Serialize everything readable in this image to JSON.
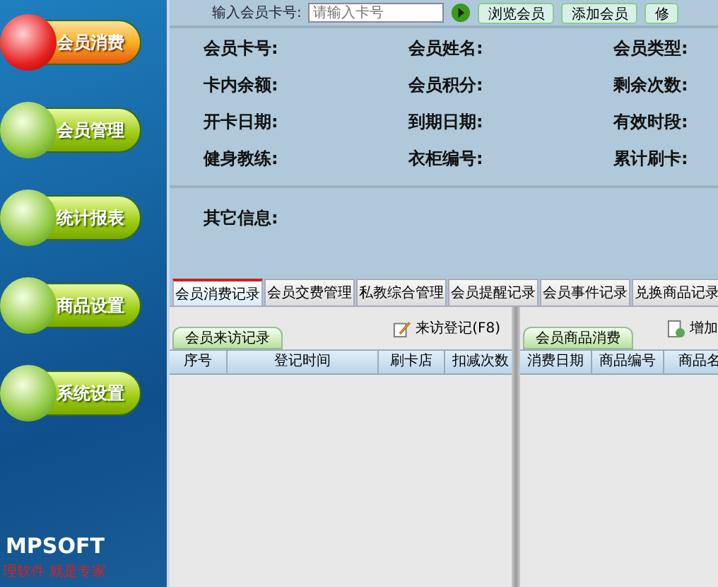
{
  "top_bar": {
    "card_label": "输入会员卡号:",
    "card_placeholder": "请输入卡号",
    "buttons": [
      "浏览会员",
      "添加会员",
      "修"
    ]
  },
  "sidebar": {
    "items": [
      {
        "label": "会员消费",
        "selected": true
      },
      {
        "label": "会员管理",
        "selected": false
      },
      {
        "label": "统计报表",
        "selected": false
      },
      {
        "label": "商品设置",
        "selected": false
      },
      {
        "label": "系统设置",
        "selected": false
      }
    ],
    "logo": "MPSOFT",
    "slogan": "理软件 就是专家"
  },
  "info": {
    "fields": [
      "会员卡号:",
      "会员姓名:",
      "会员类型:",
      "卡内余额:",
      "会员积分:",
      "剩余次数:",
      "开卡日期:",
      "到期日期:",
      "有效时段:",
      "健身教练:",
      "衣柜编号:",
      "累计刷卡:"
    ],
    "other": "其它信息:"
  },
  "tabs": [
    {
      "label": "会员消费记录",
      "selected": true
    },
    {
      "label": "会员交费管理",
      "selected": false
    },
    {
      "label": "私教综合管理",
      "selected": false
    },
    {
      "label": "会员提醒记录",
      "selected": false
    },
    {
      "label": "会员事件记录",
      "selected": false
    },
    {
      "label": "兑换商品记录",
      "selected": false
    }
  ],
  "visits": {
    "tab": "会员来访记录",
    "action": "来访登记(F8)",
    "columns": [
      "序号",
      "登记时间",
      "刷卡店",
      "扣减次数"
    ]
  },
  "purchases": {
    "tab": "会员商品消费",
    "action": "增加",
    "columns": [
      "消费日期",
      "商品编号",
      "商品名"
    ]
  }
}
